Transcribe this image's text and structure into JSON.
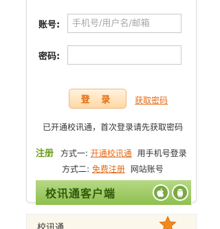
{
  "login_form": {
    "account_label": "账号:",
    "account_placeholder": "手机号/用户名/邮箱",
    "password_label": "密码:",
    "password_value": "",
    "login_button": "登 录",
    "get_password_link": "获取密码",
    "notice": "已开通校讯通，首次登录请先获取密码"
  },
  "register": {
    "tag": "注册",
    "option1_prefix": "方式一:",
    "option1_link": "开通校讯通",
    "option1_suffix": "用手机号登录",
    "option2_prefix": "方式二:",
    "option2_link": "免费注册",
    "option2_suffix": "网站账号"
  },
  "client_banner": {
    "text": "校讯通客户端",
    "icons": [
      "apple-icon",
      "android-icon"
    ]
  },
  "bottom_section": {
    "title": "校讯通"
  },
  "colors": {
    "accent_orange": "#e56a13",
    "register_green": "#6b9d1a",
    "banner_green": "#8ebf4f"
  }
}
